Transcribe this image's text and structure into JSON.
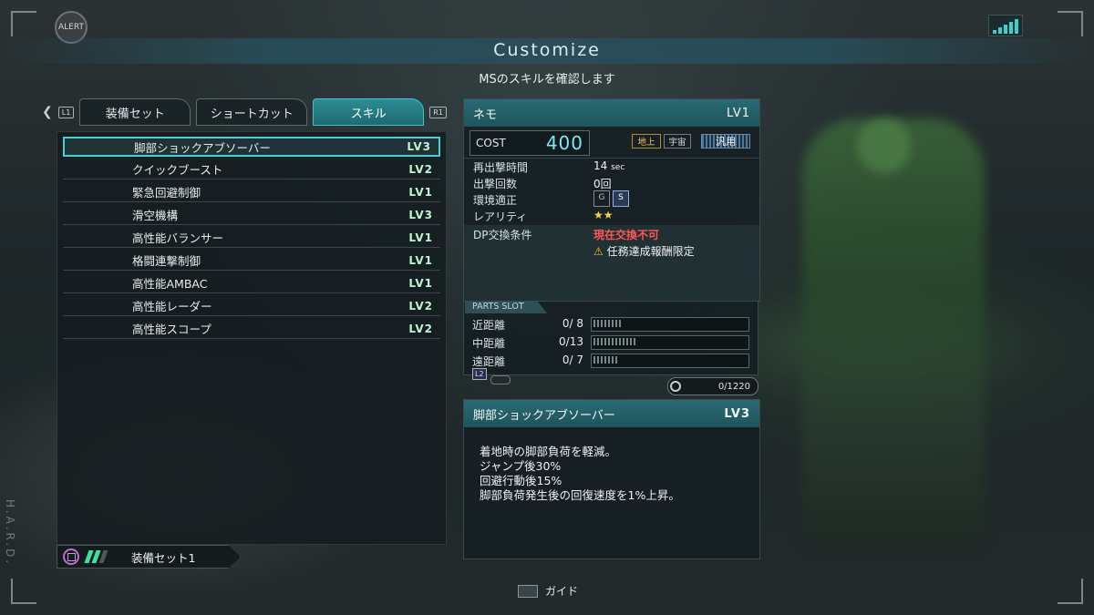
{
  "header": {
    "alert": "ALERT",
    "title": "Customize",
    "subtitle": "MSのスキルを確認します"
  },
  "tabs": {
    "left_button": "L1",
    "right_button": "R1",
    "items": [
      {
        "label": "装備セット"
      },
      {
        "label": "ショートカット"
      },
      {
        "label": "スキル",
        "active": true
      }
    ]
  },
  "skills": [
    {
      "name": "脚部ショックアブソーバー",
      "level": "LV3",
      "selected": true
    },
    {
      "name": "クイックブースト",
      "level": "LV2"
    },
    {
      "name": "緊急回避制御",
      "level": "LV1"
    },
    {
      "name": "滑空機構",
      "level": "LV3"
    },
    {
      "name": "高性能バランサー",
      "level": "LV1"
    },
    {
      "name": "格闘連撃制御",
      "level": "LV1"
    },
    {
      "name": "高性能AMBAC",
      "level": "LV1"
    },
    {
      "name": "高性能レーダー",
      "level": "LV2"
    },
    {
      "name": "高性能スコープ",
      "level": "LV2"
    }
  ],
  "loadout": {
    "label": "装備セット1",
    "bars_filled": 2,
    "bars_total": 3
  },
  "ms": {
    "name": "ネモ",
    "level": "LV1",
    "cost_label": "COST",
    "cost_value": "400",
    "env_tags": [
      "地上",
      "宇宙",
      "汎用"
    ],
    "stats": [
      {
        "label": "再出撃時間",
        "value": "14",
        "unit": "sec"
      },
      {
        "label": "出撃回数",
        "value": "0回"
      },
      {
        "label": "環境適正",
        "value": "G / S"
      },
      {
        "label": "レアリティ",
        "value": "★★"
      }
    ],
    "dp_label": "DP交換条件",
    "dp_status": "現在交換不可",
    "dp_note": "任務達成報酬限定",
    "env_icons": [
      "G",
      "S"
    ]
  },
  "parts_slot": {
    "title": "PARTS SLOT",
    "rows": [
      {
        "label": "近距離",
        "value": "0/ 8",
        "capacity": 8
      },
      {
        "label": "中距離",
        "value": "0/13",
        "capacity": 13
      },
      {
        "label": "遠距離",
        "value": "0/ 7",
        "capacity": 7
      }
    ],
    "l2": "L2",
    "counter": "0/1220"
  },
  "skill_detail": {
    "name": "脚部ショックアブソーバー",
    "level": "LV3",
    "lines": [
      "着地時の脚部負荷を軽減。",
      "ジャンプ後30%",
      "回避行動後15%",
      "脚部負荷発生後の回復速度を1%上昇。"
    ]
  },
  "footer": {
    "guide": "ガイド"
  },
  "side_text": "H.A.R.D.",
  "colors": {
    "accent": "#3ec5c8",
    "level": "#bff5ce",
    "warning": "#ff5757"
  }
}
